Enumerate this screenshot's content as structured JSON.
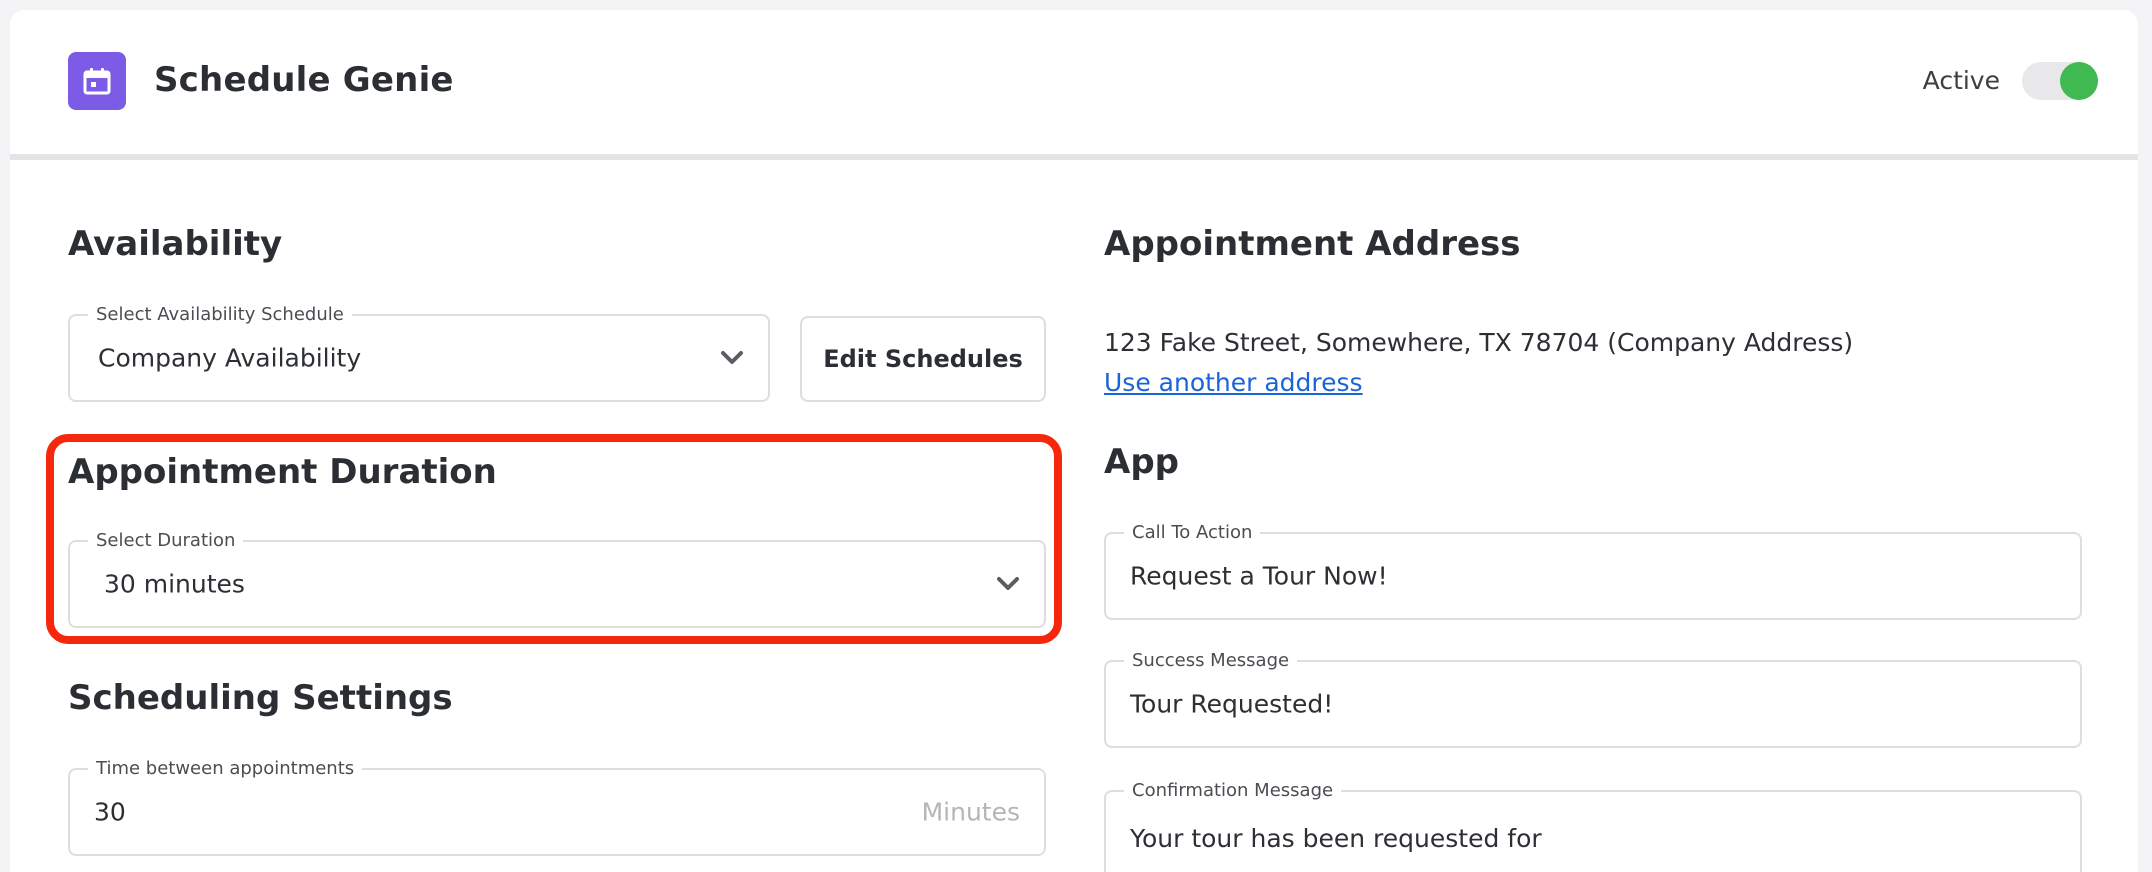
{
  "header": {
    "app_name": "Schedule Genie",
    "app_icon": "calendar-icon",
    "status_label": "Active",
    "status_on": true,
    "accent_color": "#7c5ce6",
    "toggle_color": "#3fb950"
  },
  "availability": {
    "title": "Availability",
    "schedule_legend": "Select Availability Schedule",
    "schedule_value": "Company Availability",
    "edit_button": "Edit Schedules"
  },
  "duration": {
    "title": "Appointment Duration",
    "legend": "Select Duration",
    "value": "30 minutes",
    "highlight_color": "#f5280d"
  },
  "scheduling": {
    "title": "Scheduling Settings",
    "gap_legend": "Time between appointments",
    "gap_value": "30",
    "gap_unit": "Minutes"
  },
  "address": {
    "title": "Appointment Address",
    "text": "123 Fake Street, Somewhere, TX 78704 (Company Address)",
    "link": "Use another address"
  },
  "app": {
    "title": "App",
    "cta_legend": "Call To Action",
    "cta_value": "Request a Tour Now!",
    "success_legend": "Success Message",
    "success_value": "Tour Requested!",
    "confirm_legend": "Confirmation Message",
    "confirm_value": "Your tour has been requested for"
  }
}
